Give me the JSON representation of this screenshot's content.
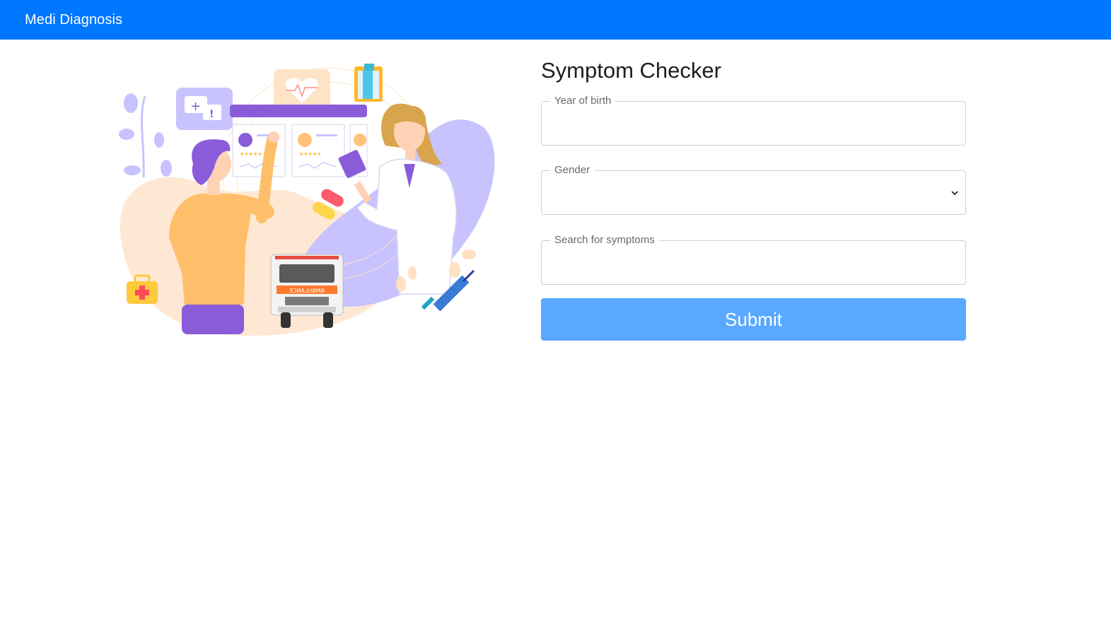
{
  "navbar": {
    "brand": "Medi Diagnosis",
    "bg_color": "#0077ff"
  },
  "illustration": {
    "icon": "doctor-consultation-illustration",
    "ambulance_text": "AMBULANCE"
  },
  "form": {
    "title": "Symptom Checker",
    "year_of_birth": {
      "label": "Year of birth",
      "value": ""
    },
    "gender": {
      "label": "Gender",
      "value": ""
    },
    "symptoms": {
      "label": "Search for symptoms",
      "value": ""
    },
    "submit_label": "Submit",
    "submit_color": "#5aa8ff"
  }
}
